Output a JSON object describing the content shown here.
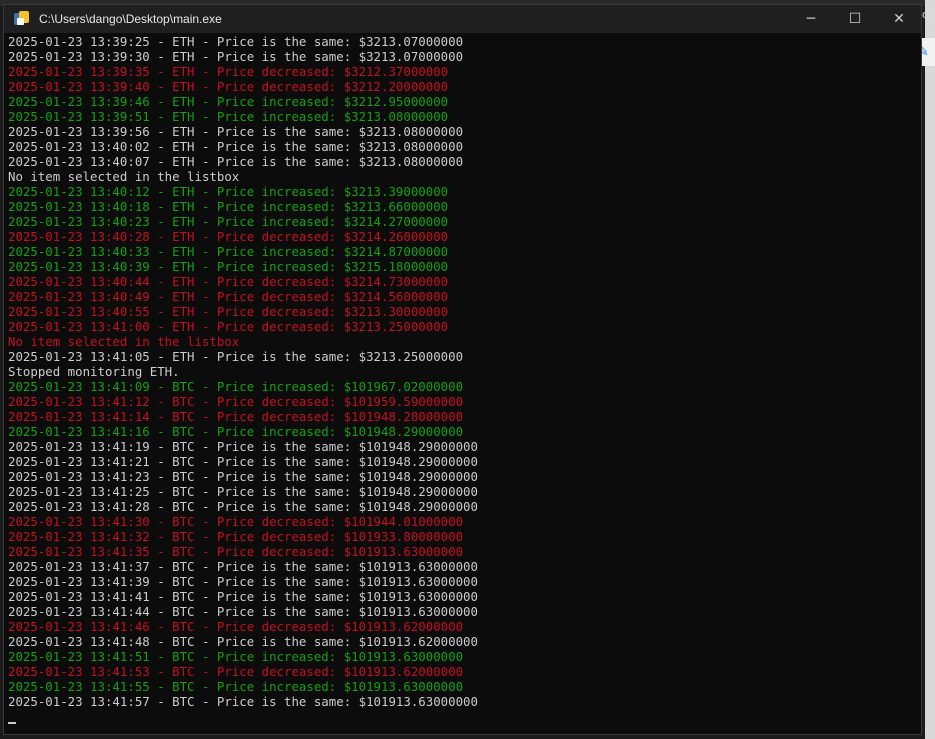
{
  "window": {
    "title": "C:\\Users\\dango\\Desktop\\main.exe",
    "minimize_symbol": "─",
    "maximize_symbol": "☐",
    "close_symbol": "✕",
    "icon": "python-icon"
  },
  "desktop": {
    "right_text": "om"
  },
  "colors": {
    "same": "#cccccc",
    "increase": "#13a10e",
    "decrease": "#c50f1f",
    "background": "#0c0c0c"
  },
  "console": {
    "lines": [
      {
        "text": "2025-01-23 13:39:25 - ETH - Price is the same: $3213.07000000",
        "kind": "same"
      },
      {
        "text": "2025-01-23 13:39:30 - ETH - Price is the same: $3213.07000000",
        "kind": "same"
      },
      {
        "text": "2025-01-23 13:39:35 - ETH - Price decreased: $3212.37000000",
        "kind": "decrease"
      },
      {
        "text": "2025-01-23 13:39:40 - ETH - Price decreased: $3212.20000000",
        "kind": "decrease"
      },
      {
        "text": "2025-01-23 13:39:46 - ETH - Price increased: $3212.95000000",
        "kind": "increase"
      },
      {
        "text": "2025-01-23 13:39:51 - ETH - Price increased: $3213.08000000",
        "kind": "increase"
      },
      {
        "text": "2025-01-23 13:39:56 - ETH - Price is the same: $3213.08000000",
        "kind": "same"
      },
      {
        "text": "2025-01-23 13:40:02 - ETH - Price is the same: $3213.08000000",
        "kind": "same"
      },
      {
        "text": "2025-01-23 13:40:07 - ETH - Price is the same: $3213.08000000",
        "kind": "same"
      },
      {
        "text": "No item selected in the listbox",
        "kind": "same"
      },
      {
        "text": "2025-01-23 13:40:12 - ETH - Price increased: $3213.39000000",
        "kind": "increase"
      },
      {
        "text": "2025-01-23 13:40:18 - ETH - Price increased: $3213.66000000",
        "kind": "increase"
      },
      {
        "text": "2025-01-23 13:40:23 - ETH - Price increased: $3214.27000000",
        "kind": "increase"
      },
      {
        "text": "2025-01-23 13:40:28 - ETH - Price decreased: $3214.26000000",
        "kind": "decrease"
      },
      {
        "text": "2025-01-23 13:40:33 - ETH - Price increased: $3214.87000000",
        "kind": "increase"
      },
      {
        "text": "2025-01-23 13:40:39 - ETH - Price increased: $3215.18000000",
        "kind": "increase"
      },
      {
        "text": "2025-01-23 13:40:44 - ETH - Price decreased: $3214.73000000",
        "kind": "decrease"
      },
      {
        "text": "2025-01-23 13:40:49 - ETH - Price decreased: $3214.56000000",
        "kind": "decrease"
      },
      {
        "text": "2025-01-23 13:40:55 - ETH - Price decreased: $3213.30000000",
        "kind": "decrease"
      },
      {
        "text": "2025-01-23 13:41:00 - ETH - Price decreased: $3213.25000000",
        "kind": "decrease"
      },
      {
        "text": "No item selected in the listbox",
        "kind": "decrease"
      },
      {
        "text": "2025-01-23 13:41:05 - ETH - Price is the same: $3213.25000000",
        "kind": "same"
      },
      {
        "text": "Stopped monitoring ETH.",
        "kind": "same"
      },
      {
        "text": "2025-01-23 13:41:09 - BTC - Price increased: $101967.02000000",
        "kind": "increase"
      },
      {
        "text": "2025-01-23 13:41:12 - BTC - Price decreased: $101959.59000000",
        "kind": "decrease"
      },
      {
        "text": "2025-01-23 13:41:14 - BTC - Price decreased: $101948.28000000",
        "kind": "decrease"
      },
      {
        "text": "2025-01-23 13:41:16 - BTC - Price increased: $101948.29000000",
        "kind": "increase"
      },
      {
        "text": "2025-01-23 13:41:19 - BTC - Price is the same: $101948.29000000",
        "kind": "same"
      },
      {
        "text": "2025-01-23 13:41:21 - BTC - Price is the same: $101948.29000000",
        "kind": "same"
      },
      {
        "text": "2025-01-23 13:41:23 - BTC - Price is the same: $101948.29000000",
        "kind": "same"
      },
      {
        "text": "2025-01-23 13:41:25 - BTC - Price is the same: $101948.29000000",
        "kind": "same"
      },
      {
        "text": "2025-01-23 13:41:28 - BTC - Price is the same: $101948.29000000",
        "kind": "same"
      },
      {
        "text": "2025-01-23 13:41:30 - BTC - Price decreased: $101944.01000000",
        "kind": "decrease"
      },
      {
        "text": "2025-01-23 13:41:32 - BTC - Price decreased: $101933.80000000",
        "kind": "decrease"
      },
      {
        "text": "2025-01-23 13:41:35 - BTC - Price decreased: $101913.63000000",
        "kind": "decrease"
      },
      {
        "text": "2025-01-23 13:41:37 - BTC - Price is the same: $101913.63000000",
        "kind": "same"
      },
      {
        "text": "2025-01-23 13:41:39 - BTC - Price is the same: $101913.63000000",
        "kind": "same"
      },
      {
        "text": "2025-01-23 13:41:41 - BTC - Price is the same: $101913.63000000",
        "kind": "same"
      },
      {
        "text": "2025-01-23 13:41:44 - BTC - Price is the same: $101913.63000000",
        "kind": "same"
      },
      {
        "text": "2025-01-23 13:41:46 - BTC - Price decreased: $101913.62000000",
        "kind": "decrease"
      },
      {
        "text": "2025-01-23 13:41:48 - BTC - Price is the same: $101913.62000000",
        "kind": "same"
      },
      {
        "text": "2025-01-23 13:41:51 - BTC - Price increased: $101913.63000000",
        "kind": "increase"
      },
      {
        "text": "2025-01-23 13:41:53 - BTC - Price decreased: $101913.62000000",
        "kind": "decrease"
      },
      {
        "text": "2025-01-23 13:41:55 - BTC - Price increased: $101913.63000000",
        "kind": "increase"
      },
      {
        "text": "2025-01-23 13:41:57 - BTC - Price is the same: $101913.63000000",
        "kind": "same"
      }
    ]
  }
}
